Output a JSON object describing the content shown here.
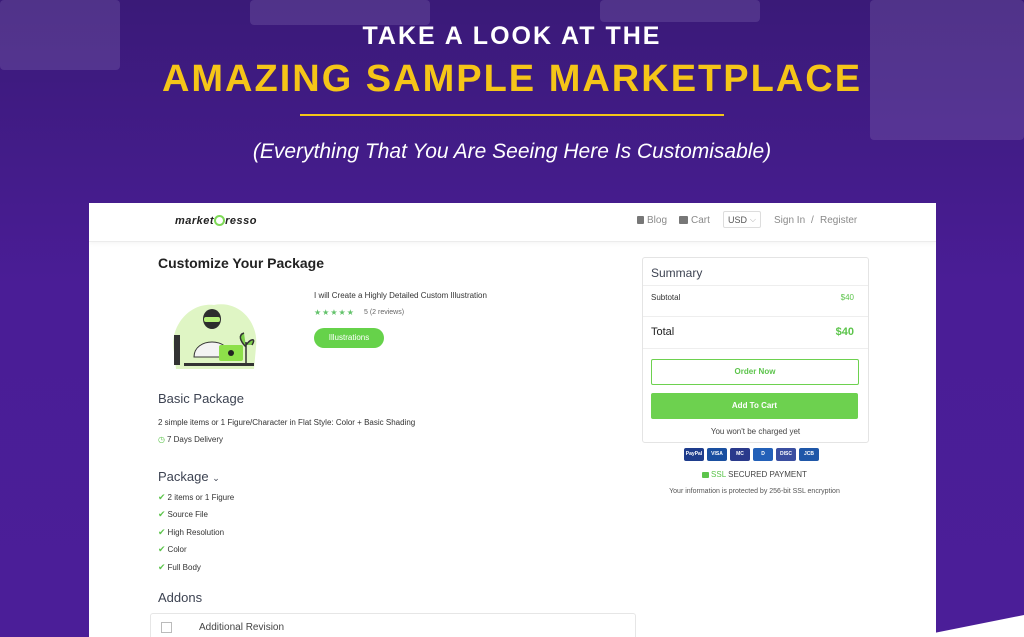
{
  "hero": {
    "kicker": "TAKE A LOOK AT THE",
    "title": "AMAZING SAMPLE MARKETPLACE",
    "subtitle": "(Everything That You Are Seeing Here Is Customisable)"
  },
  "navbar": {
    "logo": "marketpresso",
    "logo_pre": "market",
    "logo_post": "resso",
    "items": [
      {
        "label": "Blog",
        "icon": "blog-icon"
      },
      {
        "label": "Cart",
        "icon": "cart-icon"
      }
    ],
    "currency": "USD",
    "sign_in": "Sign In",
    "separator": "/",
    "register": "Register"
  },
  "main": {
    "heading": "Customize Your Package",
    "product": {
      "title": "I will Create a Highly Detailed Custom Illustration",
      "rating": 5,
      "rating_text": "5 (2 reviews)",
      "category": "Illustrations"
    },
    "basic": {
      "heading": "Basic Package",
      "description": "2 simple items or 1 Figure/Character in Flat Style: Color + Basic Shading",
      "delivery": "7 Days Delivery"
    },
    "package": {
      "heading": "Package",
      "features": [
        "2 items or 1 Figure",
        "Source File",
        "High Resolution",
        "Color",
        "Full Body"
      ]
    },
    "addons": {
      "heading": "Addons",
      "first_label": "Additional Revision"
    }
  },
  "summary": {
    "title": "Summary",
    "subtotal_label": "Subtotal",
    "subtotal_value": "$40",
    "total_label": "Total",
    "total_value": "$40",
    "order_now": "Order Now",
    "add_to_cart": "Add To Cart",
    "note": "You won't be charged yet"
  },
  "payments": [
    {
      "label": "PayPal",
      "color": "#1e3c8c"
    },
    {
      "label": "VISA",
      "color": "#1a4fa0"
    },
    {
      "label": "MC",
      "color": "#2a3a8c"
    },
    {
      "label": "D",
      "color": "#2360b8"
    },
    {
      "label": "DISC",
      "color": "#3a4ea0"
    },
    {
      "label": "JCB",
      "color": "#1f57a8"
    }
  ],
  "security": {
    "ssl": "SSL",
    "secured": "SECURED PAYMENT",
    "encryption": "Your information is protected by 256-bit SSL encryption"
  },
  "colors": {
    "accent": "#6dd14f",
    "title_gold": "#f5c518",
    "bg_purple": "#4a1d96"
  }
}
